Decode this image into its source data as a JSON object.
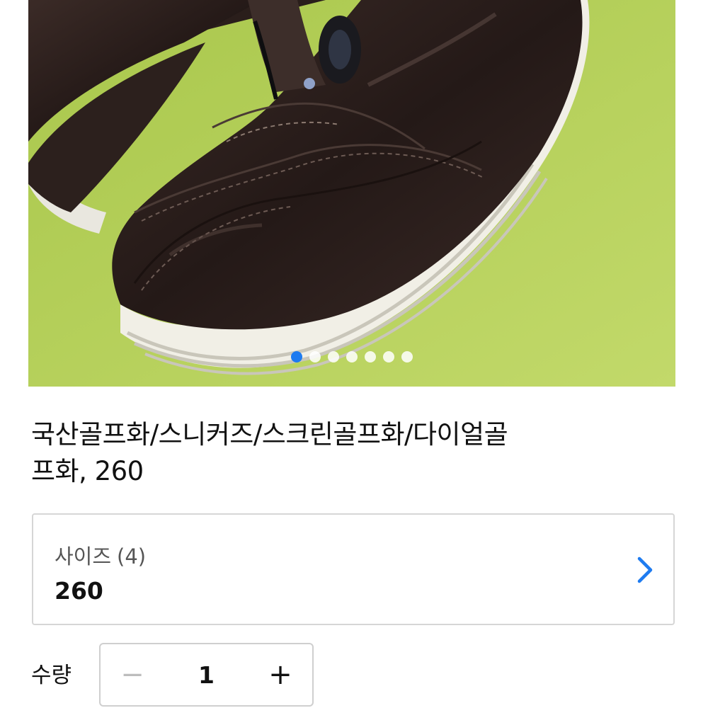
{
  "product": {
    "title_line1": "국산골프화/스니커즈/스크린골프화/다이얼골",
    "title_line2": "프화, 260"
  },
  "carousel": {
    "image_alt": "brown leather golf shoe with dial closure",
    "slide_count": 7,
    "active_index": 0,
    "background_color": "#b6cf5a",
    "active_dot_color": "#1e7bf0"
  },
  "option": {
    "label": "사이즈",
    "count": "(4)",
    "value": "260",
    "icon": "chevron-right-icon",
    "accent_color": "#1e7bf0"
  },
  "quantity": {
    "label": "수량",
    "value": "1",
    "minus_label": "−",
    "plus_label": "+"
  }
}
